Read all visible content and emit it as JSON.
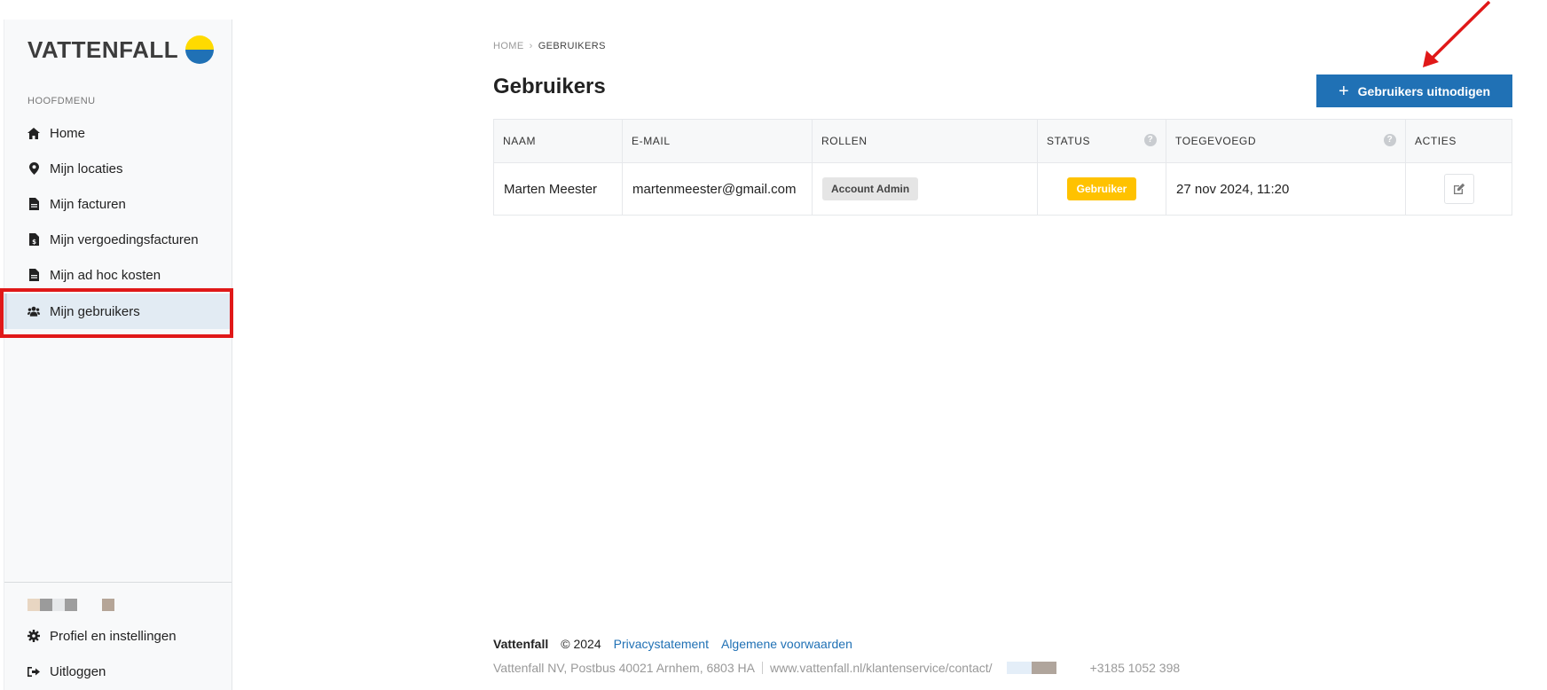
{
  "brand": {
    "logo_text": "VATTENFALL"
  },
  "sidebar": {
    "heading": "HOOFDMENU",
    "items": [
      {
        "label": "Home",
        "icon": "home-icon"
      },
      {
        "label": "Mijn locaties",
        "icon": "map-pin-icon"
      },
      {
        "label": "Mijn facturen",
        "icon": "document-icon"
      },
      {
        "label": "Mijn vergoedingsfacturen",
        "icon": "document-euro-icon"
      },
      {
        "label": "Mijn ad hoc kosten",
        "icon": "document-icon"
      },
      {
        "label": "Mijn gebruikers",
        "icon": "users-icon",
        "active": true
      }
    ],
    "bottom_items": [
      {
        "label": "Profiel en instellingen",
        "icon": "gear-icon"
      },
      {
        "label": "Uitloggen",
        "icon": "logout-icon"
      }
    ]
  },
  "breadcrumb": {
    "home": "HOME",
    "current": "GEBRUIKERS"
  },
  "page": {
    "title": "Gebruikers",
    "invite_button": "Gebruikers uitnodigen"
  },
  "table": {
    "columns": [
      "NAAM",
      "E-MAIL",
      "ROLLEN",
      "STATUS",
      "TOEGEVOEGD",
      "ACTIES"
    ],
    "rows": [
      {
        "name": "Marten Meester",
        "email": "martenmeester@gmail.com",
        "role": "Account Admin",
        "status": "Gebruiker",
        "added": "27 nov 2024, 11:20"
      }
    ]
  },
  "footer": {
    "brand": "Vattenfall",
    "copyright": "© 2024",
    "privacy": "Privacystatement",
    "terms": "Algemene voorwaarden",
    "address": "Vattenfall NV, Postbus 40021 Arnhem, 6803 HA",
    "url": "www.vattenfall.nl/klantenservice/contact/",
    "phone": "+3185 1052 398"
  },
  "colors": {
    "accent": "#2071b5",
    "status_yellow": "#ffc200",
    "highlight_red": "#e01818"
  }
}
